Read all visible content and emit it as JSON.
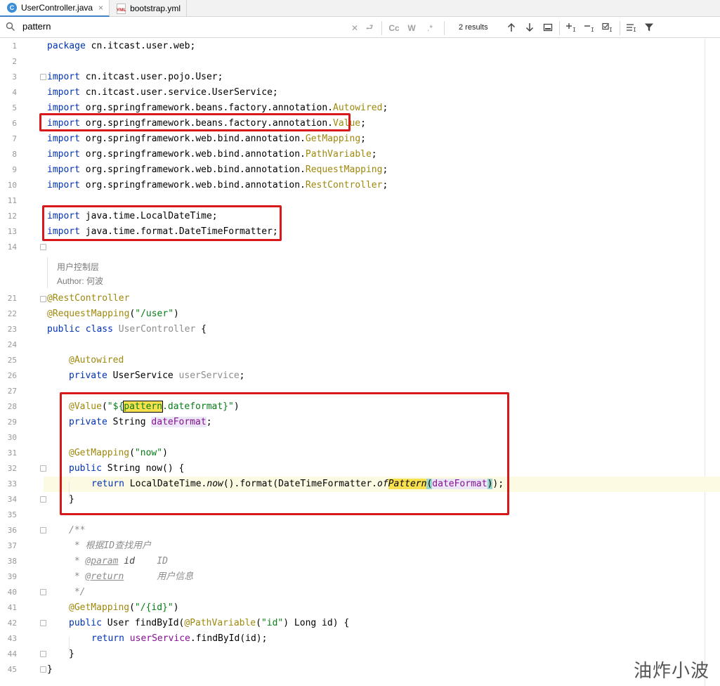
{
  "tabs": [
    {
      "label": "UserController.java",
      "icon": "java-class-icon",
      "active": true
    },
    {
      "label": "bootstrap.yml",
      "icon": "yml-file-icon",
      "active": false
    }
  ],
  "search": {
    "query": "pattern",
    "results": "2 results",
    "match_case": "Cc",
    "words": "W",
    "regex": ".*"
  },
  "gutter": [
    "1",
    "2",
    "3",
    "4",
    "5",
    "6",
    "7",
    "8",
    "9",
    "10",
    "11",
    "12",
    "13",
    "14",
    "21",
    "22",
    "23",
    "24",
    "25",
    "26",
    "27",
    "28",
    "29",
    "30",
    "31",
    "32",
    "33",
    "34",
    "35",
    "36",
    "37",
    "38",
    "39",
    "40",
    "41",
    "42",
    "43",
    "44",
    "45"
  ],
  "code": {
    "l1": {
      "kw": "package",
      "rest": " cn.itcast.user.web;"
    },
    "l3": {
      "kw": "import",
      "rest": " cn.itcast.user.pojo.User;"
    },
    "l4": {
      "kw": "import",
      "rest": " cn.itcast.user.service.UserService;"
    },
    "l5": {
      "kw": "import",
      "rest": " org.springframework.beans.factory.annotation.",
      "ann": "Autowired",
      "end": ";"
    },
    "l6": {
      "kw": "import",
      "rest": " org.springframework.beans.factory.annotation.",
      "ann": "Value",
      "end": ";"
    },
    "l7": {
      "kw": "import",
      "rest": " org.springframework.web.bind.annotation.",
      "ann": "GetMapping",
      "end": ";"
    },
    "l8": {
      "kw": "import",
      "rest": " org.springframework.web.bind.annotation.",
      "ann": "PathVariable",
      "end": ";"
    },
    "l9": {
      "kw": "import",
      "rest": " org.springframework.web.bind.annotation.",
      "ann": "RequestMapping",
      "end": ";"
    },
    "l10": {
      "kw": "import",
      "rest": " org.springframework.web.bind.annotation.",
      "ann": "RestController",
      "end": ";"
    },
    "l12": {
      "kw": "import",
      "rest": " java.time.LocalDateTime;"
    },
    "l13": {
      "kw": "import",
      "rest": " java.time.format.DateTimeFormatter;"
    },
    "doc1": "用户控制层",
    "doc2": "Author: 何波",
    "l21": {
      "ann": "@RestController"
    },
    "l22": {
      "ann": "@RequestMapping",
      "open": "(",
      "str": "\"/user\"",
      "close": ")"
    },
    "l23": {
      "kw1": "public",
      "kw2": "class",
      "name": "UserController",
      "rest": " {"
    },
    "l25": {
      "ann": "@Autowired"
    },
    "l26": {
      "kw": "private",
      "type": " UserService ",
      "field": "userService",
      "end": ";"
    },
    "l28": {
      "ann": "@Value",
      "open": "(",
      "str1": "\"${",
      "match": "pattern",
      "str2": ".dateformat}\"",
      "close": ")"
    },
    "l29": {
      "kw": "private",
      "type": " String ",
      "field": "dateFormat",
      "end": ";"
    },
    "l31": {
      "ann": "@GetMapping",
      "open": "(",
      "str": "\"now\"",
      "close": ")"
    },
    "l32": {
      "kw": "public",
      "rest": " String now() {"
    },
    "l33": {
      "kw": "return",
      "a": " LocalDateTime.",
      "now": "now",
      "b": "().format(DateTimeFormatter.",
      "of": "of",
      "pat": "Pattern",
      "p1": "(",
      "field": "dateFormat",
      "p2": ")",
      "end": ");"
    },
    "l34": "}",
    "l36": "/**",
    "l37": {
      "star": " * ",
      "text": "根据ID查找用户"
    },
    "l38": {
      "star": " * ",
      "tag": "@param",
      "name": " id    ",
      "desc": "ID"
    },
    "l39": {
      "star": " * ",
      "tag": "@return",
      "desc": "      用户信息"
    },
    "l40": " */",
    "l41": {
      "ann": "@GetMapping",
      "open": "(",
      "str": "\"/{id}\"",
      "close": ")"
    },
    "l42": {
      "kw": "public",
      "type": " User findById(",
      "ann": "@PathVariable",
      "open": "(",
      "str": "\"id\"",
      "rest": ") Long id) {"
    },
    "l43": {
      "kw": "return",
      "field": " userService",
      "rest": ".findById(id);"
    },
    "l44": "}",
    "l45": "}"
  },
  "watermark": "油炸小波"
}
